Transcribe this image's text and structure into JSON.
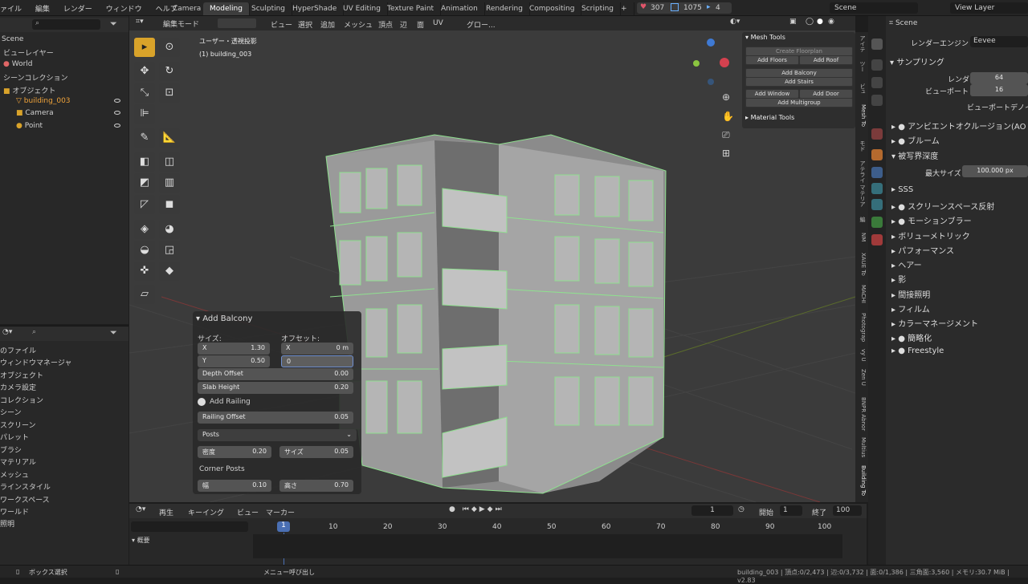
{
  "topbar": {
    "menu": [
      "ァイル",
      "編集",
      "レンダー",
      "ウィンドウ",
      "ヘルプ"
    ],
    "tabs": [
      "Camera",
      "Modeling",
      "Sculpting",
      "HyperShade",
      "UV Editing",
      "Texture Paint",
      "Animation",
      "Rendering",
      "Compositing",
      "Scripting",
      "+"
    ],
    "counts": [
      "307",
      "1075",
      "4"
    ],
    "scene": "Scene",
    "view_layer": "View Layer"
  },
  "header3d": {
    "mode": "編集モード",
    "menus": [
      "ビュー",
      "選択",
      "追加",
      "メッシュ",
      "頂点",
      "辺",
      "面",
      "UV"
    ],
    "orientation": "グロー..."
  },
  "outliner": {
    "scene": "Scene",
    "view_layer": "ビューレイヤー",
    "world": "World",
    "collection": "シーンコレクション",
    "objects": "オブジェクト",
    "items": [
      "building_003",
      "Camera",
      "Point"
    ]
  },
  "blendfile": {
    "title": "のファイル",
    "items": [
      "ウィンドウマネージャ",
      "オブジェクト",
      "カメラ設定",
      "コレクション",
      "シーン",
      "スクリーン",
      "パレット",
      "ブラシ",
      "マテリアル",
      "メッシュ",
      "ラインスタイル",
      "ワークスペース",
      "ワールド",
      "照明"
    ]
  },
  "viewport": {
    "title": "ユーザー・透視投影",
    "object": "(1) building_003"
  },
  "npanel": {
    "header": "Mesh Tools",
    "floorplan": "Create Floorplan",
    "add_floors": "Add Floors",
    "add_roof": "Add Roof",
    "add_balcony": "Add Balcony",
    "add_stairs": "Add Stairs",
    "add_window": "Add Window",
    "add_door": "Add Door",
    "add_multigroup": "Add Multigroup",
    "material_tools": "Material Tools",
    "vtabs": [
      "アイテ",
      "ツー",
      "ビュ",
      "Mesh To",
      "モド",
      "アテライ",
      "マテリア",
      "編",
      "NM",
      "XAUE To",
      "MACHI",
      "Photograp",
      "vy U",
      "Zen U",
      "BNPR Abnor",
      "Multius",
      "Building To"
    ]
  },
  "op": {
    "title": "Add Balcony",
    "size_label": "サイズ:",
    "offset_label": "オフセット:",
    "x": "X",
    "y": "Y",
    "size_x": "1.30",
    "size_y": "0.50",
    "off_x": "0 m",
    "off_y": "0",
    "depth_offset": "Depth Offset",
    "depth_val": "0.00",
    "slab_height": "Slab Height",
    "slab_val": "0.20",
    "add_railing": "Add Railing",
    "railing_offset": "Railing Offset",
    "railing_val": "0.05",
    "posts": "Posts",
    "density": "密度",
    "density_val": "0.20",
    "size2": "サイズ",
    "size2_val": "0.05",
    "corner_posts": "Corner Posts",
    "width": "幅",
    "width_val": "0.10",
    "height": "高さ",
    "height_val": "0.70"
  },
  "props": {
    "scene": "Scene",
    "engine_label": "レンダーエンジン",
    "engine": "Eevee",
    "sampling": "サンプリング",
    "render": "レンダー",
    "render_val": "64",
    "viewport": "ビューポート",
    "viewport_val": "16",
    "denoise": "ビューポートデノイ",
    "sections": [
      "アンビエントオクルージョン(AO",
      "ブルーム",
      "被写界深度"
    ],
    "max_size": "最大サイズ",
    "max_size_val": "100.000 px",
    "more": [
      "SSS",
      "スクリーンスペース反射",
      "モーションブラー",
      "ボリューメトリック",
      "パフォーマンス",
      "ヘアー",
      "影",
      "間接照明",
      "フィルム",
      "カラーマネージメント",
      "簡略化",
      "Freestyle"
    ]
  },
  "timeline": {
    "playback": "再生",
    "keying": "キーイング",
    "view": "ビュー",
    "marker": "マーカー",
    "frame": "1",
    "start_label": "開始",
    "start": "1",
    "end_label": "終了",
    "end": "100",
    "ticks": [
      "1",
      "10",
      "20",
      "30",
      "40",
      "50",
      "60",
      "70",
      "80",
      "90",
      "100"
    ],
    "summary": "概要"
  },
  "status": {
    "left": "ボックス選択",
    "mid": "メニュー呼び出し",
    "right": "building_003 | 頂点:0/2,473 | 辺:0/3,732 | 面:0/1,386 | 三角面:3,560 | メモリ:30.7 MiB | v2.83"
  }
}
